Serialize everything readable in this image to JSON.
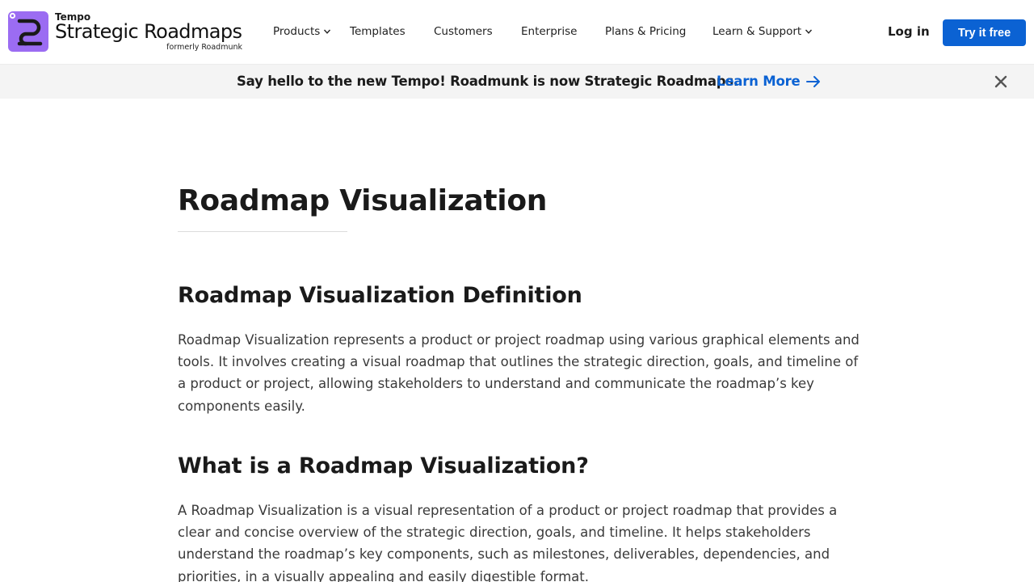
{
  "header": {
    "logo": {
      "tempo": "Tempo",
      "name": "Strategic Roadmaps",
      "formerly": "formerly Roadmunk",
      "brand_color": "#9b6cf2"
    },
    "nav": [
      {
        "label": "Products",
        "has_dropdown": true
      },
      {
        "label": "Templates",
        "has_dropdown": false
      },
      {
        "label": "Customers",
        "has_dropdown": false
      },
      {
        "label": "Enterprise",
        "has_dropdown": false
      },
      {
        "label": "Plans & Pricing",
        "has_dropdown": false
      },
      {
        "label": "Learn & Support",
        "has_dropdown": true
      }
    ],
    "login_label": "Log in",
    "cta_label": "Try it free",
    "cta_color": "#0b62d3"
  },
  "banner": {
    "text": "Say hello to the new Tempo! Roadmunk is now Strategic Roadmaps.",
    "link_label": "Learn More",
    "link_icon": "arrow-right-icon",
    "close_icon": "close-icon"
  },
  "content": {
    "title": "Roadmap Visualization",
    "sections": [
      {
        "heading": "Roadmap Visualization Definition",
        "body": "Roadmap Visualization represents a product or project roadmap using various graphical elements and tools. It involves creating a visual roadmap that outlines the strategic direction, goals, and timeline of a product or project, allowing stakeholders to understand and communicate the roadmap’s key components easily."
      },
      {
        "heading": "What is a Roadmap Visualization?",
        "body": "A Roadmap Visualization is a visual representation of a product or project roadmap that provides a clear and concise overview of the strategic direction, goals, and timeline. It helps stakeholders understand the roadmap’s key components, such as milestones, deliverables, dependencies, and priorities, in a visually appealing and easily digestible format."
      }
    ]
  }
}
